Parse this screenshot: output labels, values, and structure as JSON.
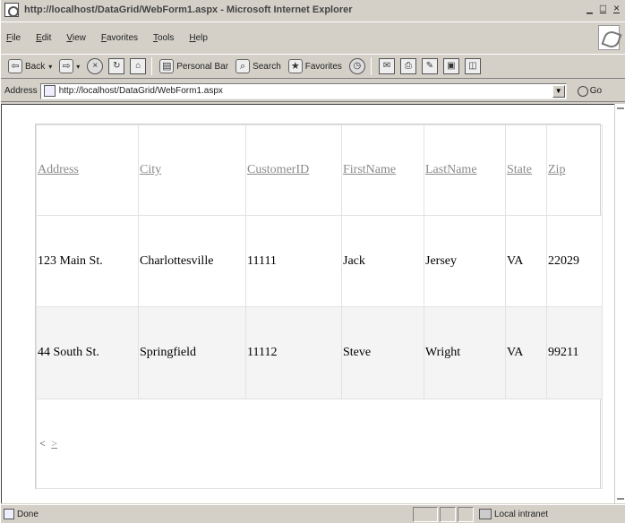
{
  "window": {
    "title": "http://localhost/DataGrid/WebForm1.aspx - Microsoft Internet Explorer",
    "controls": [
      "_",
      "□",
      "×"
    ]
  },
  "menu": [
    "File",
    "Edit",
    "View",
    "Favorites",
    "Tools",
    "Help"
  ],
  "toolbar": {
    "back_label": "Back",
    "personal_bar_label": "Personal Bar",
    "search_label": "Search",
    "favorites_label": "Favorites"
  },
  "address": {
    "label": "Address",
    "url": "http://localhost/DataGrid/WebForm1.aspx",
    "go_label": "Go"
  },
  "grid": {
    "columns": [
      "Address",
      "City",
      "CustomerID",
      "FirstName",
      "LastName",
      "State",
      "Zip"
    ],
    "rows": [
      [
        "123 Main St.",
        "Charlottesville",
        "11111",
        "Jack",
        "Jersey",
        "VA",
        "22029"
      ],
      [
        "44 South St.",
        "Springfield",
        "11112",
        "Steve",
        "Wright",
        "VA",
        "99211"
      ]
    ],
    "pager": {
      "prev": "<",
      "next": ">"
    }
  },
  "status": {
    "text": "Done",
    "zone": "Local intranet"
  }
}
